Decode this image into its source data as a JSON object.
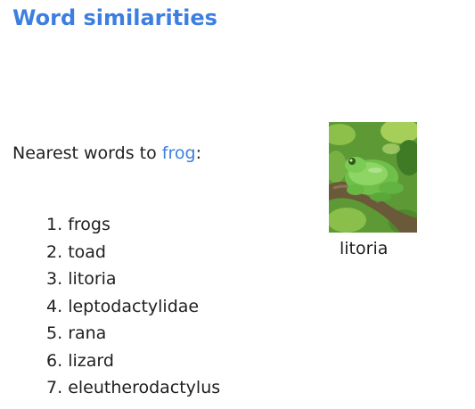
{
  "slide": {
    "title": "Word similarities",
    "subtitle_prefix": "Nearest words to ",
    "query_word": "frog",
    "subtitle_suffix": ":",
    "results": [
      {
        "rank": "1.",
        "word": "frogs"
      },
      {
        "rank": "2.",
        "word": "toad"
      },
      {
        "rank": "3.",
        "word": "litoria"
      },
      {
        "rank": "4.",
        "word": "leptodactylidae"
      },
      {
        "rank": "5.",
        "word": "rana"
      },
      {
        "rank": "6.",
        "word": "lizard"
      },
      {
        "rank": "7.",
        "word": "eleutherodactylus"
      }
    ],
    "image_caption": "litoria"
  },
  "colors": {
    "accent": "#3d7fe0",
    "text": "#1f1f1f",
    "background": "#ffffff"
  }
}
